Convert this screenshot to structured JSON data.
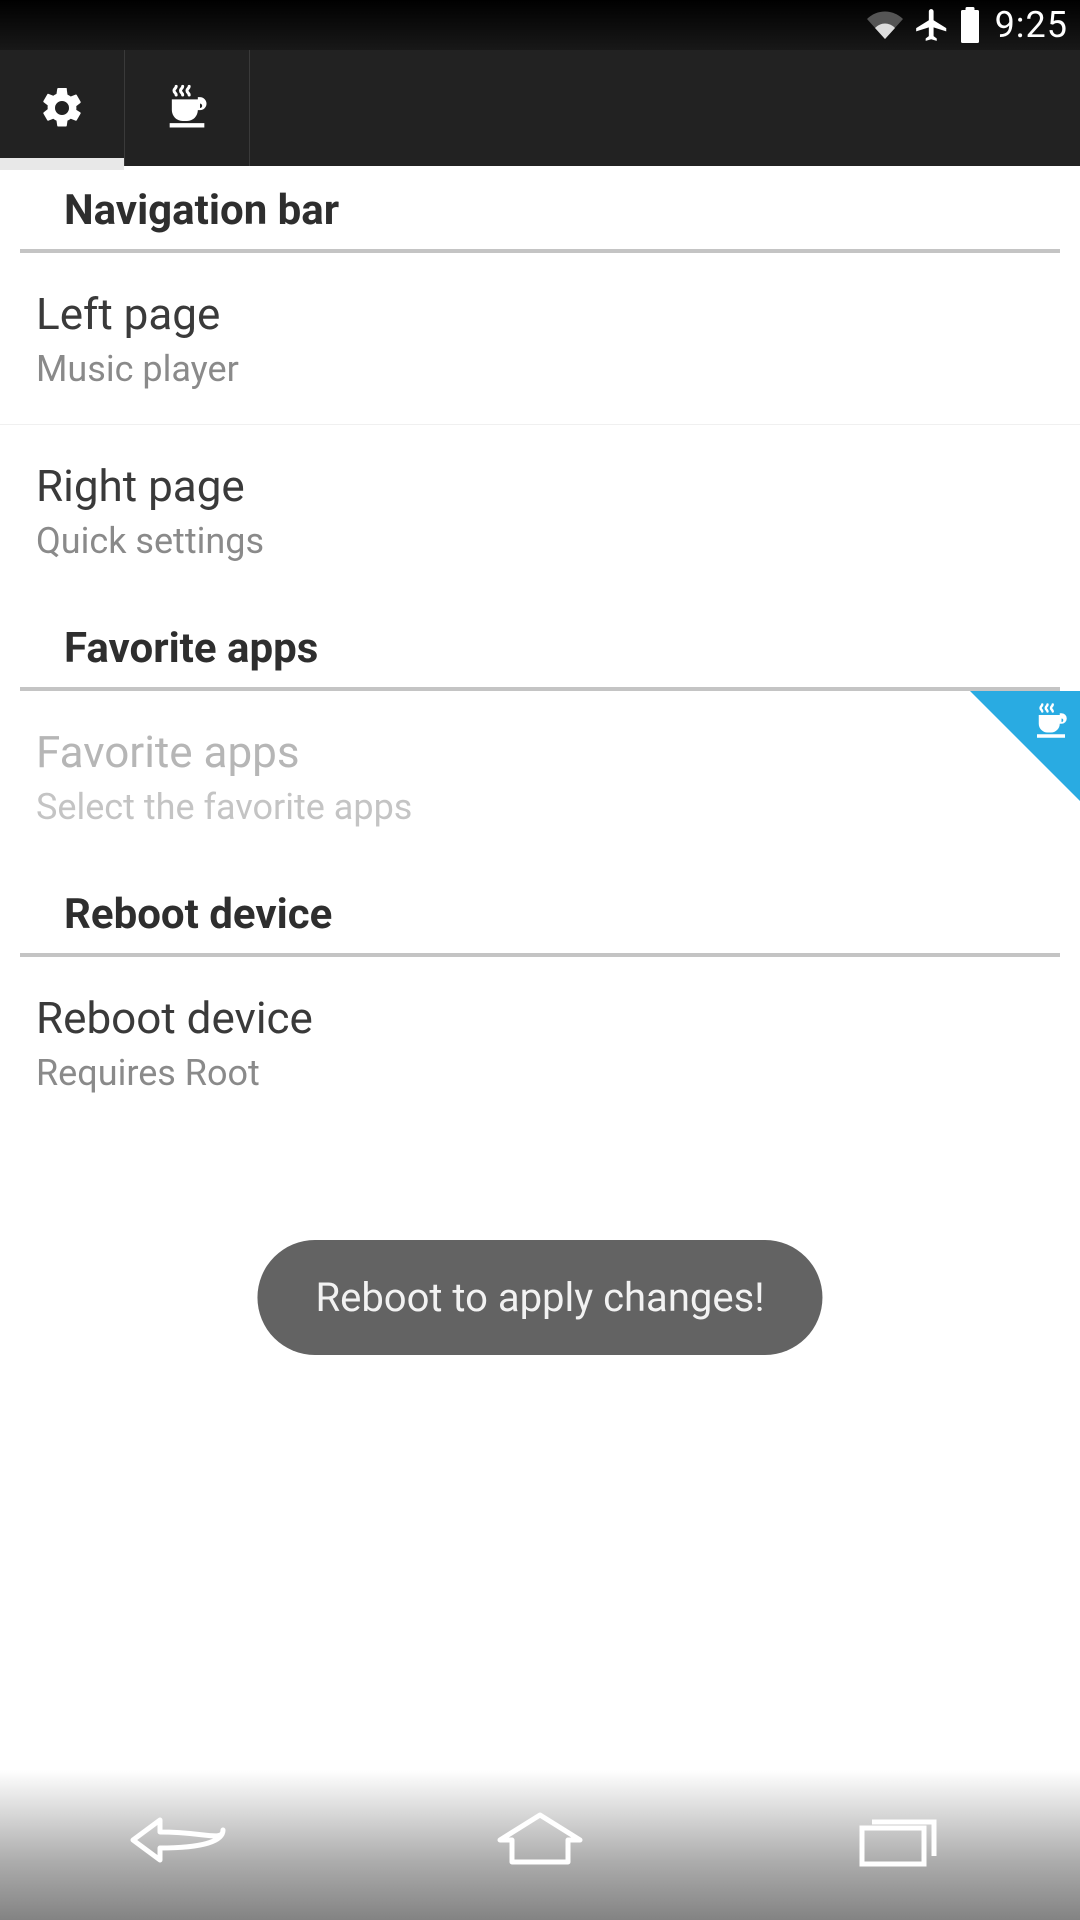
{
  "status": {
    "time": "9:25"
  },
  "sections": {
    "navigation_bar": {
      "header": "Navigation bar",
      "left_page_title": "Left page",
      "left_page_subtitle": "Music player",
      "right_page_title": "Right page",
      "right_page_subtitle": "Quick settings"
    },
    "favorite_apps": {
      "header": "Favorite apps",
      "item_title": "Favorite apps",
      "item_subtitle": "Select the favorite apps"
    },
    "reboot": {
      "header": "Reboot device",
      "item_title": "Reboot device",
      "item_subtitle": "Requires Root"
    }
  },
  "toast": {
    "message": "Reboot to apply changes!"
  }
}
